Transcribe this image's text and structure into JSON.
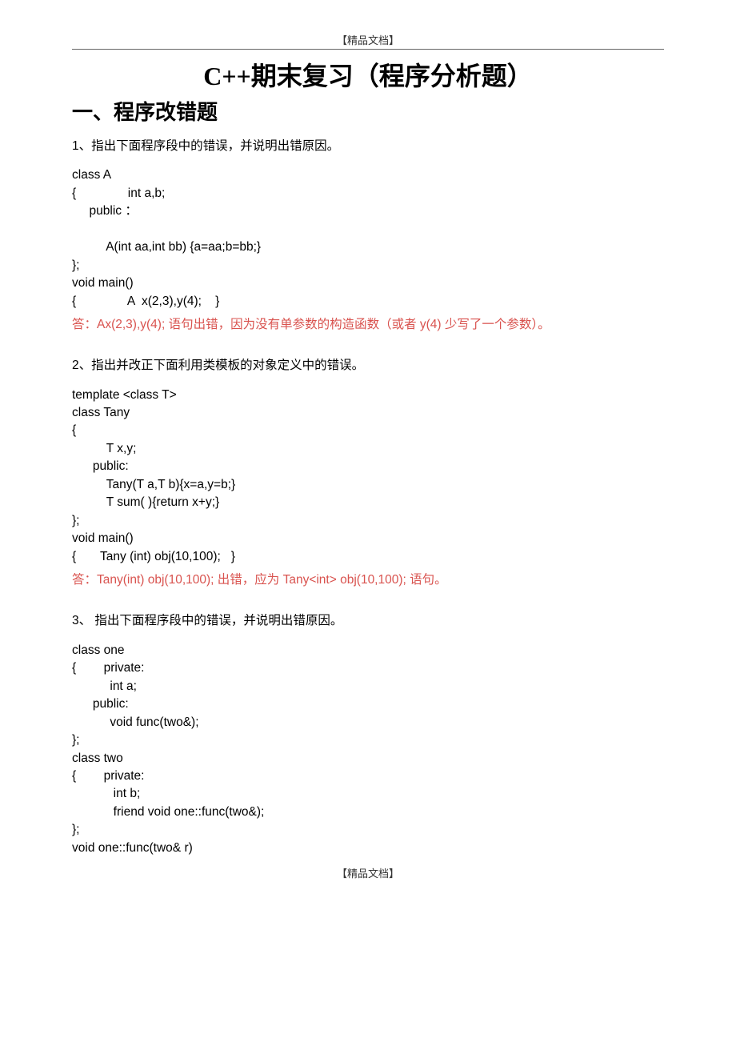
{
  "header_tag": "【精品文档】",
  "title": "C++期末复习（程序分析题）",
  "section_heading": "一、程序改错题",
  "q1": {
    "prompt": "1、指出下面程序段中的错误，并说明出错原因。",
    "code": "class A\n{               int a,b;\n     public ：\n\n          A(int aa,int bb) {a=aa;b=bb;}\n};\nvoid main()\n{               A  x(2,3),y(4);    }",
    "answer": "答：Ax(2,3),y(4); 语句出错，因为没有单参数的构造函数（或者 y(4) 少写了一个参数）。"
  },
  "q2": {
    "prompt": "2、指出并改正下面利用类模板的对象定义中的错误。",
    "code": "template <class T>\nclass Tany\n{\n          T x,y;\n      public:\n          Tany(T a,T b){x=a,y=b;}\n          T sum( ){return x+y;}\n};\nvoid main()\n{       Tany (int) obj(10,100);   }",
    "answer": "答：Tany(int) obj(10,100); 出错，应为 Tany<int> obj(10,100); 语句。"
  },
  "q3": {
    "prompt": "3、 指出下面程序段中的错误，并说明出错原因。",
    "code": "class one\n{        private:\n           int a;\n      public:\n           void func(two&);\n};\nclass two\n{        private:\n            int b;\n            friend void one::func(two&);\n};\nvoid one::func(two& r)"
  },
  "footer_tag": "【精品文档】"
}
